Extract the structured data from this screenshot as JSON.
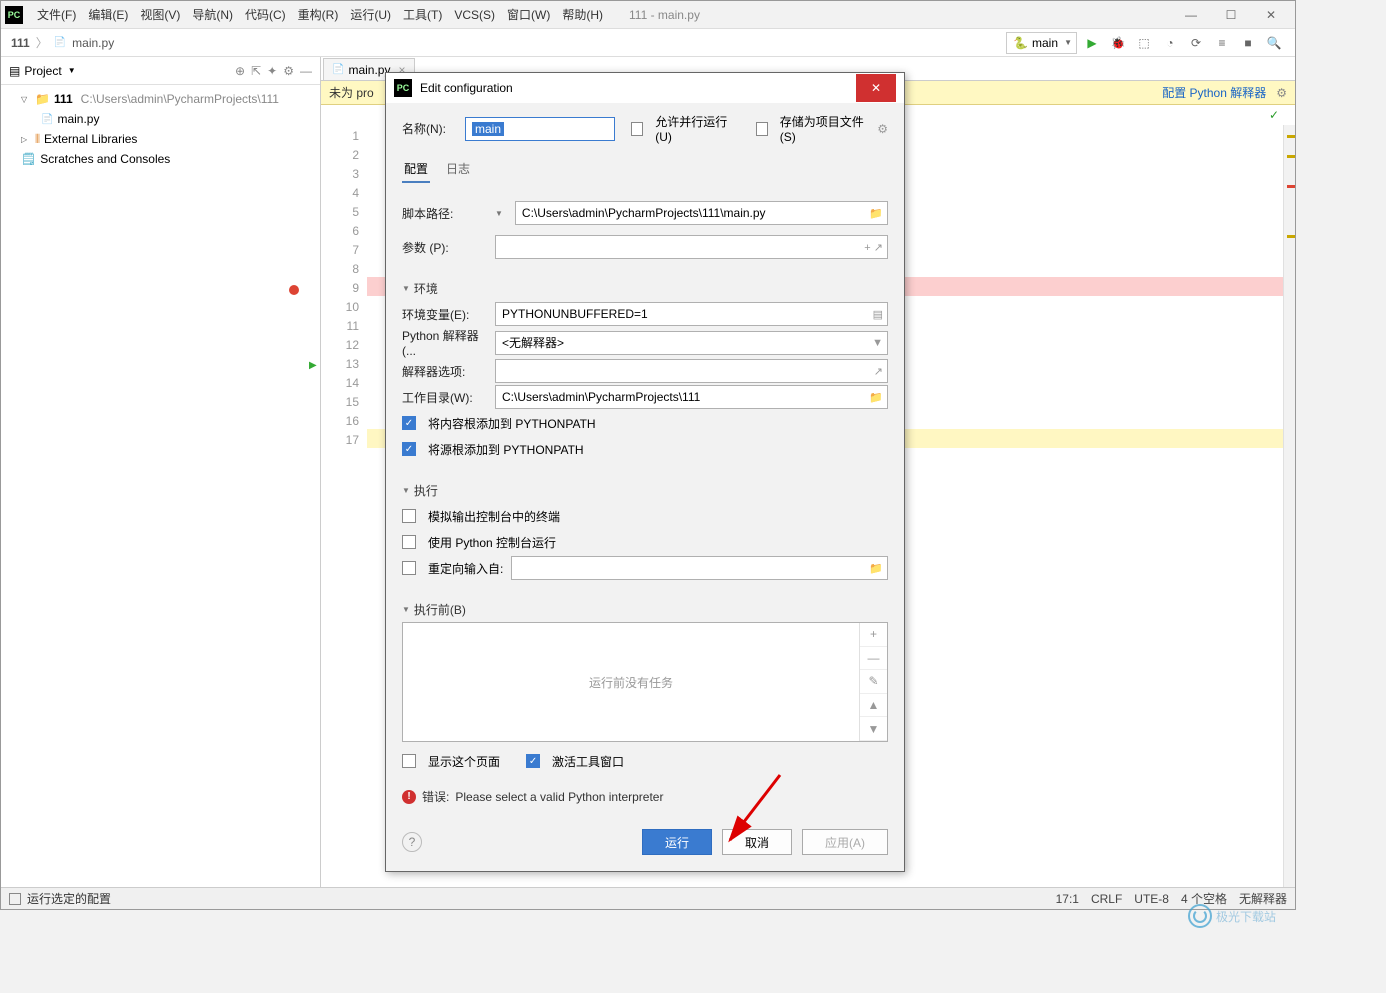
{
  "titlebar": {
    "menu": [
      "文件(F)",
      "编辑(E)",
      "视图(V)",
      "导航(N)",
      "代码(C)",
      "重构(R)",
      "运行(U)",
      "工具(T)",
      "VCS(S)",
      "窗口(W)",
      "帮助(H)"
    ],
    "title": "111 - main.py"
  },
  "breadcrumb": {
    "p1": "111",
    "p2": "main.py"
  },
  "toolbar": {
    "run_config": "main"
  },
  "sidebar": {
    "header": "Project",
    "project_root": "111",
    "project_path": "C:\\Users\\admin\\PycharmProjects\\111",
    "file": "main.py",
    "ext_lib": "External Libraries",
    "scratches": "Scratches and Consoles"
  },
  "editor": {
    "tab": "main.py",
    "banner_left": "未为 pro",
    "banner_link": "配置 Python 解释器",
    "lines": [
      "1",
      "2",
      "3",
      "4",
      "5",
      "6",
      "7",
      "8",
      "9",
      "10",
      "11",
      "12",
      "13",
      "14",
      "15",
      "16",
      "17"
    ]
  },
  "dialog": {
    "title": "Edit configuration",
    "name_label": "名称(N):",
    "name_value": "main",
    "allow_parallel": "允许并行运行(U)",
    "store_project": "存储为项目文件(S)",
    "tab_config": "配置",
    "tab_log": "日志",
    "script_label": "脚本路径:",
    "script_value": "C:\\Users\\admin\\PycharmProjects\\111\\main.py",
    "params_label": "参数 (P):",
    "env_section": "环境",
    "envvar_label": "环境变量(E):",
    "envvar_value": "PYTHONUNBUFFERED=1",
    "interp_label": "Python 解释器(...",
    "interp_value": "<无解释器>",
    "interp_opts_label": "解释器选项:",
    "workdir_label": "工作目录(W):",
    "workdir_value": "C:\\Users\\admin\\PycharmProjects\\111",
    "add_content_roots": "将内容根添加到 PYTHONPATH",
    "add_source_roots": "将源根添加到 PYTHONPATH",
    "exec_section": "执行",
    "emulate_term": "模拟输出控制台中的终端",
    "use_py_console": "使用 Python 控制台运行",
    "redirect_input": "重定向输入自:",
    "before_section": "执行前(B)",
    "task_empty": "运行前没有任务",
    "show_page": "显示这个页面",
    "activate_tool": "激活工具窗口",
    "error_label": "错误:",
    "error_text": "Please select a valid Python interpreter",
    "btn_run": "运行",
    "btn_cancel": "取消",
    "btn_apply": "应用(A)"
  },
  "status": {
    "left": "运行选定的配置",
    "pos": "17:1",
    "crlf": "CRLF",
    "enc": "UTE-8",
    "indent": "4 个空格",
    "interp": "无解释器"
  },
  "watermark": "极光下载站"
}
